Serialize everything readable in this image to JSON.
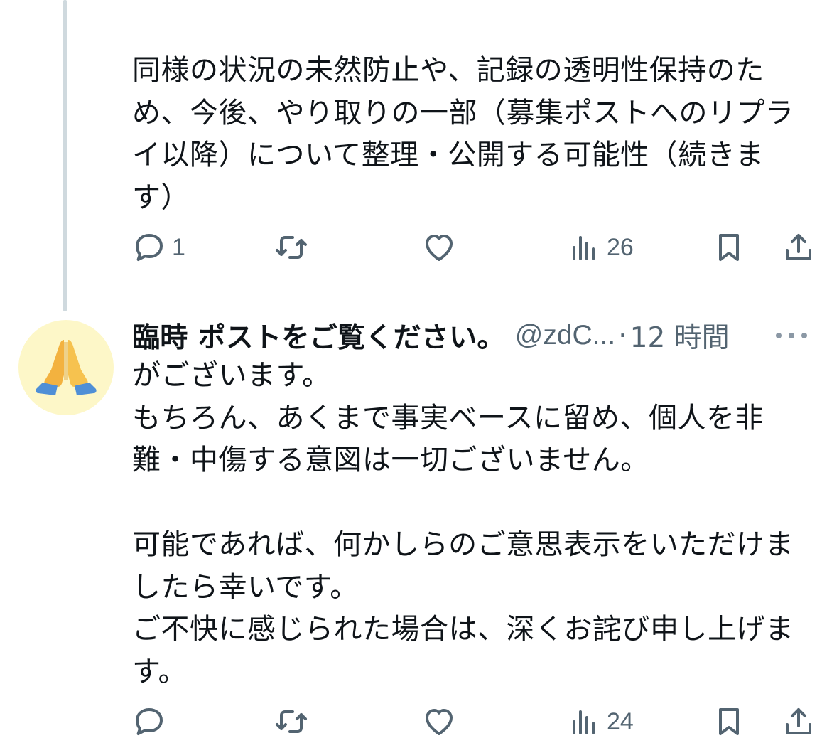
{
  "thread": {
    "tweet1": {
      "text": "同様の状況の未然防止や、記録の透明性保持のため、今後、やり取りの一部（募集ポストへのリプライ以降）について整理・公開する可能性（続きます）",
      "actions": {
        "reply_count": "1",
        "retweet_count": "",
        "like_count": "",
        "views_count": "26"
      }
    },
    "tweet2": {
      "display_name": "臨時 ポストをご覧ください。",
      "handle": "@zdC...",
      "separator": "·",
      "timestamp": "12 時間",
      "text": "がございます。\nもちろん、あくまで事実ベースに留め、個人を非難・中傷する意図は一切ございません。\n\n可能であれば、何かしらのご意思表示をいただけましたら幸いです。\nご不快に感じられた場合は、深くお詫び申し上げます。",
      "actions": {
        "reply_count": "",
        "retweet_count": "",
        "like_count": "",
        "views_count": "24"
      }
    }
  },
  "icons": {
    "avatar": "folded-hands-emoji",
    "reply": "reply-icon",
    "retweet": "retweet-icon",
    "like": "heart-icon",
    "views": "views-icon",
    "bookmark": "bookmark-icon",
    "share": "share-icon",
    "more": "more-icon"
  },
  "colors": {
    "text": "#0f1419",
    "secondary": "#536471",
    "thread_line": "#cfd9de",
    "avatar_bg": "#fdf7c8"
  }
}
